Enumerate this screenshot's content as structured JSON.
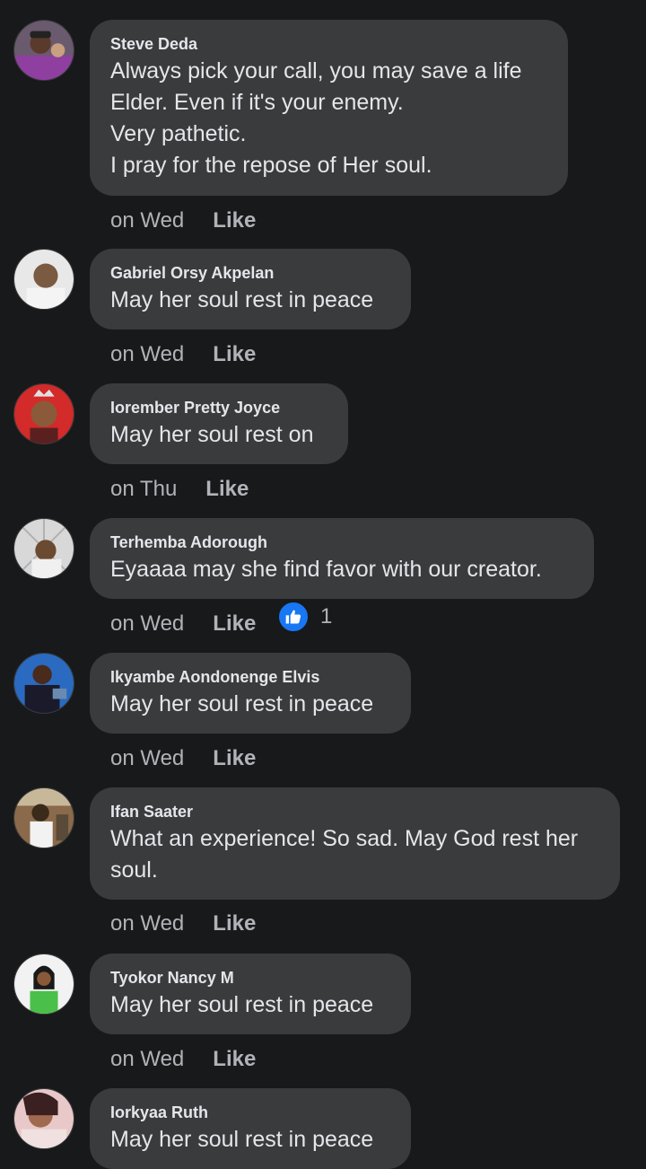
{
  "comments": [
    {
      "author": "Steve Deda",
      "lines": [
        "Always pick your call, you may save a life",
        "Elder. Even if it's your enemy.",
        "Very pathetic.",
        "I pray for the repose of Her soul."
      ],
      "time": "on Wed",
      "like_label": "Like"
    },
    {
      "author": "Gabriel Orsy Akpelan",
      "lines": [
        "May her soul rest in peace"
      ],
      "time": "on Wed",
      "like_label": "Like"
    },
    {
      "author": "Iorember Pretty Joyce",
      "lines": [
        "May her soul rest on"
      ],
      "time": "on Thu",
      "like_label": "Like"
    },
    {
      "author": "Terhemba Adorough",
      "lines": [
        "Eyaaaa may she find favor with our creator."
      ],
      "time": "on Wed",
      "like_label": "Like",
      "reaction_count": "1"
    },
    {
      "author": "Ikyambe Aondonenge Elvis",
      "lines": [
        "May her soul rest in peace"
      ],
      "time": "on Wed",
      "like_label": "Like"
    },
    {
      "author": "Ifan Saater",
      "lines": [
        "What an experience! So sad. May God rest her",
        "soul."
      ],
      "time": "on Wed",
      "like_label": "Like"
    },
    {
      "author": "Tyokor Nancy M",
      "lines": [
        "May her soul rest in peace"
      ],
      "time": "on Wed",
      "like_label": "Like"
    },
    {
      "author": "Iorkyaa Ruth",
      "lines": [
        "May her soul rest in peace"
      ]
    }
  ],
  "colors": {
    "background": "#18191a",
    "bubble": "#3a3b3c",
    "text": "#e4e6eb",
    "meta": "#b0b3b8",
    "like_badge": "#1877f2"
  },
  "icons": {
    "reaction": "thumbs-up-icon"
  }
}
